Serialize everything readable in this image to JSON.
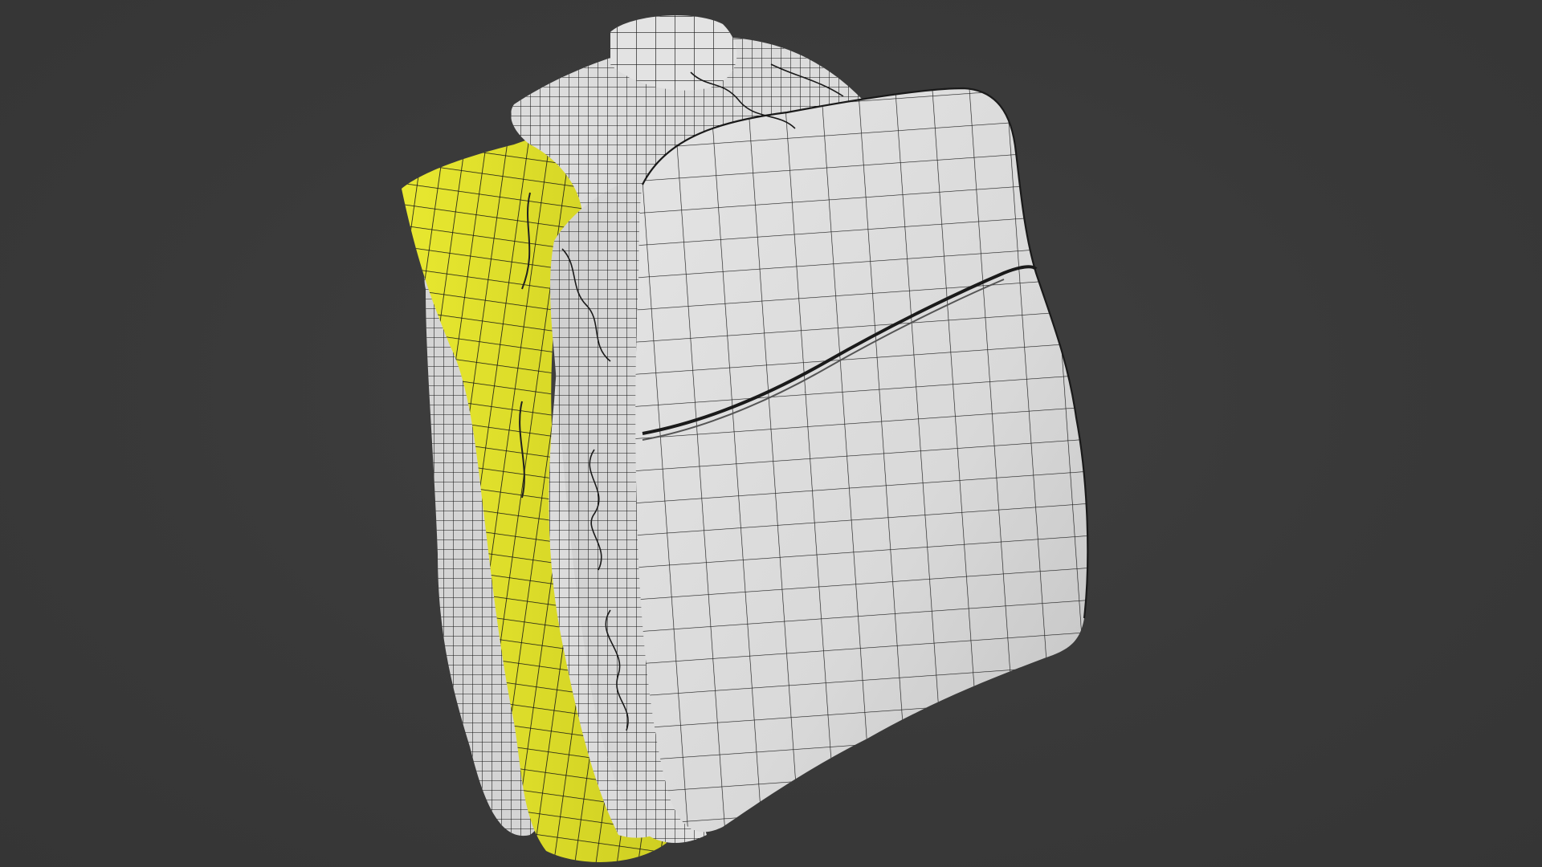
{
  "viewport": {
    "background_color": "#393939",
    "object_name": "backpack-mesh",
    "display_mode": "wireframe-on-solid",
    "colors": {
      "base_mesh": "#e6e6e6",
      "base_mesh_shadow": "#bdbdbd",
      "selected_faces": "#dede2a",
      "selected_faces_shadow": "#b8b820",
      "wire": "#141414"
    }
  }
}
